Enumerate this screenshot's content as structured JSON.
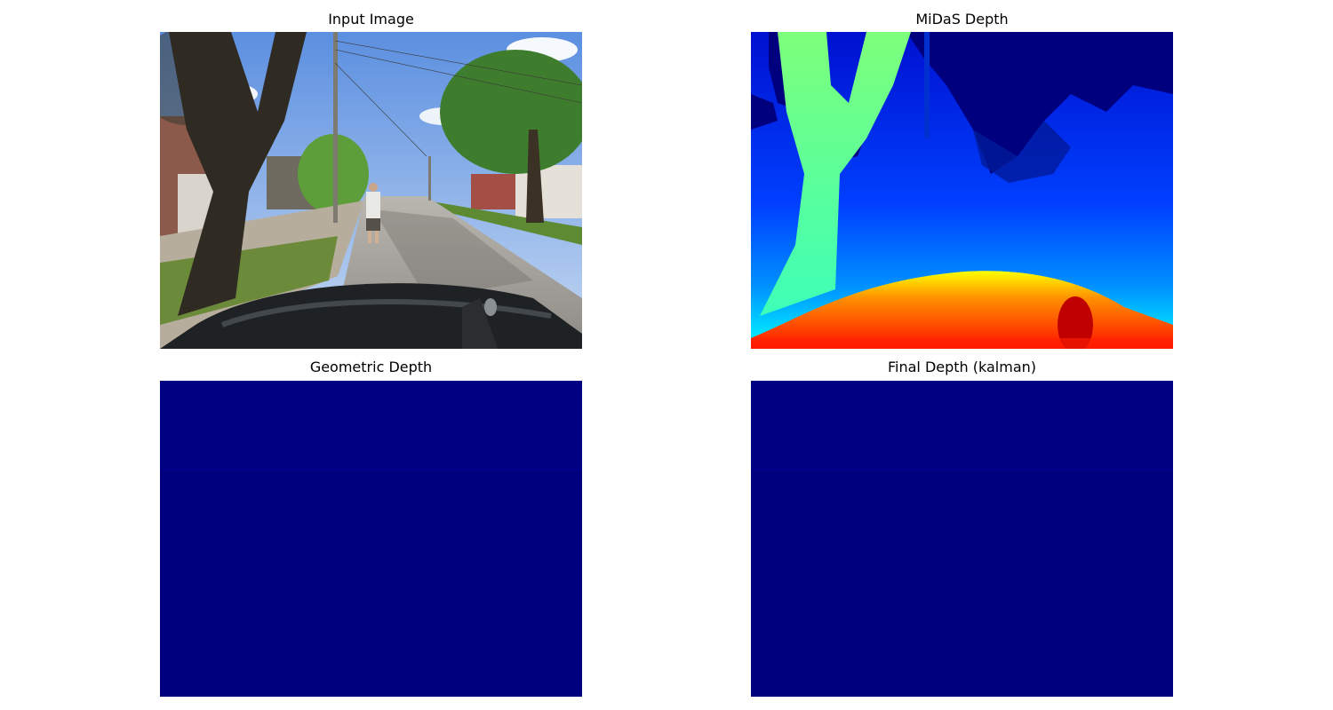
{
  "figure": {
    "panels": [
      {
        "title": "Input Image"
      },
      {
        "title": "MiDaS Depth"
      },
      {
        "title": "Geometric Depth"
      },
      {
        "title": "Final Depth (kalman)"
      }
    ]
  },
  "colors": {
    "background": "#ffffff",
    "jet_min": "#00007f",
    "jet_low": "#0000ff",
    "jet_cyan": "#00ffff",
    "jet_green": "#7fff7f",
    "jet_yellow": "#ffff00",
    "jet_orange": "#ff7f00",
    "jet_red": "#ff0000",
    "jet_max": "#7f0000"
  }
}
